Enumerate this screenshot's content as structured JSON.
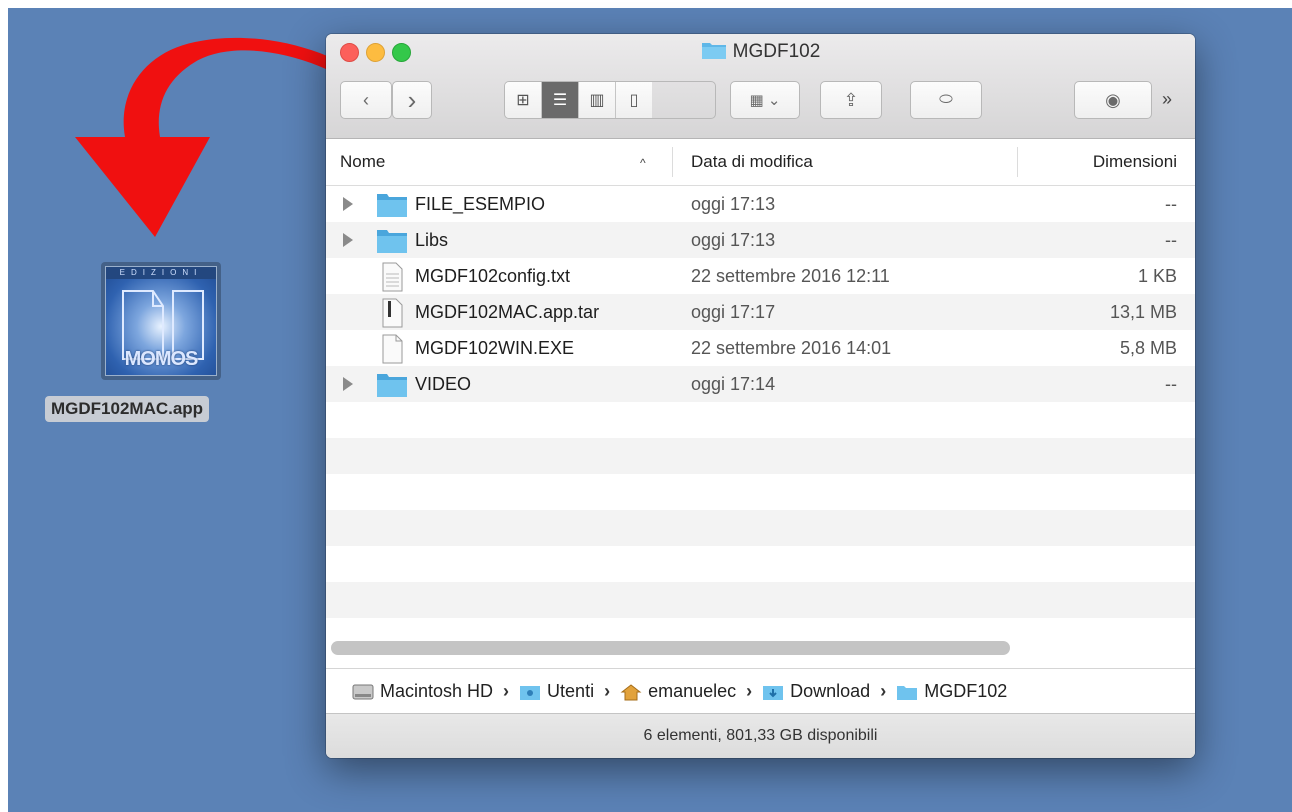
{
  "desktop": {
    "app_icon_label": "MGDF102MAC.app",
    "app_icon_banner": "EDIZIONI",
    "app_icon_logo": "MOMOS"
  },
  "window": {
    "title": "MGDF102",
    "columns": {
      "name": "Nome",
      "date": "Data di modifica",
      "size": "Dimensioni"
    },
    "files": [
      {
        "name": "FILE_ESEMPIO",
        "date": "oggi 17:13",
        "size": "--",
        "type": "folder"
      },
      {
        "name": "Libs",
        "date": "oggi 17:13",
        "size": "--",
        "type": "folder"
      },
      {
        "name": "MGDF102config.txt",
        "date": "22 settembre 2016 12:11",
        "size": "1 KB",
        "type": "text-file"
      },
      {
        "name": "MGDF102MAC.app.tar",
        "date": "oggi 17:17",
        "size": "13,1 MB",
        "type": "archive"
      },
      {
        "name": "MGDF102WIN.EXE",
        "date": "22 settembre 2016 14:01",
        "size": "5,8 MB",
        "type": "document"
      },
      {
        "name": "VIDEO",
        "date": "oggi 17:14",
        "size": "--",
        "type": "folder"
      }
    ],
    "path": [
      "Macintosh HD",
      "Utenti",
      "emanuelec",
      "Download",
      "MGDF102"
    ],
    "status": "6 elementi, 801,33 GB disponibili"
  },
  "colors": {
    "desktop": "#5b82b6",
    "arrow": "#f01010",
    "folder": "#5fb7e8"
  }
}
